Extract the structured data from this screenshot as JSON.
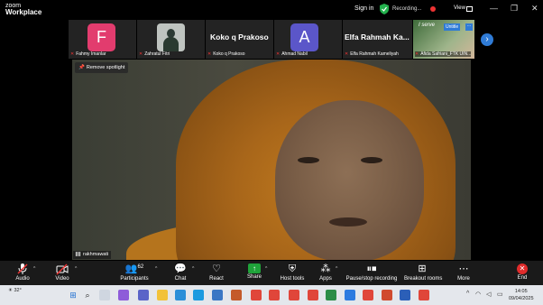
{
  "app": {
    "logo_line1": "zoom",
    "logo_line2": "Workplace",
    "sign_in": "Sign in",
    "recording": "Recording...",
    "view": "View",
    "window_controls": {
      "minimize": "—",
      "maximize": "❐",
      "close": "✕"
    }
  },
  "participants_strip": [
    {
      "type": "avatar",
      "initial": "F",
      "color": "#e23c6e",
      "name": "Fahmy Imanlar"
    },
    {
      "type": "photo",
      "name": "Zahratul Fitri"
    },
    {
      "type": "name",
      "display": "Koko q Prakoso",
      "name": "Koko q Prakoso"
    },
    {
      "type": "avatar",
      "initial": "A",
      "color": "#5b56c9",
      "name": "Ahmad Nabil"
    },
    {
      "type": "name",
      "display": "Elfa Rahmah Ka...",
      "name": "Elfa Rahmah Kameliyah"
    },
    {
      "type": "scene",
      "caption": "I serve",
      "badge": "Untitle",
      "more": "···",
      "name": "Afida Safriani_FTK UIN..."
    }
  ],
  "spotlight": {
    "label": "Remove spotlight"
  },
  "main_video": {
    "name": "rakhmawati"
  },
  "toolbar": {
    "audio": "Audio",
    "video": "Video",
    "participants": "Participants",
    "participants_count": "62",
    "chat": "Chat",
    "react": "React",
    "share": "Share",
    "host_tools": "Host tools",
    "apps": "Apps",
    "record": "Pause/stop recording",
    "breakout": "Breakout rooms",
    "more": "More",
    "end": "End"
  },
  "taskbar": {
    "temperature": "32°",
    "time": "14:05",
    "date": "09/04/2025",
    "colors": {
      "accent": "#2f7bd6",
      "mute_red": "#e33",
      "share_green": "#1fa33a",
      "end_red": "#e02b2b"
    }
  }
}
